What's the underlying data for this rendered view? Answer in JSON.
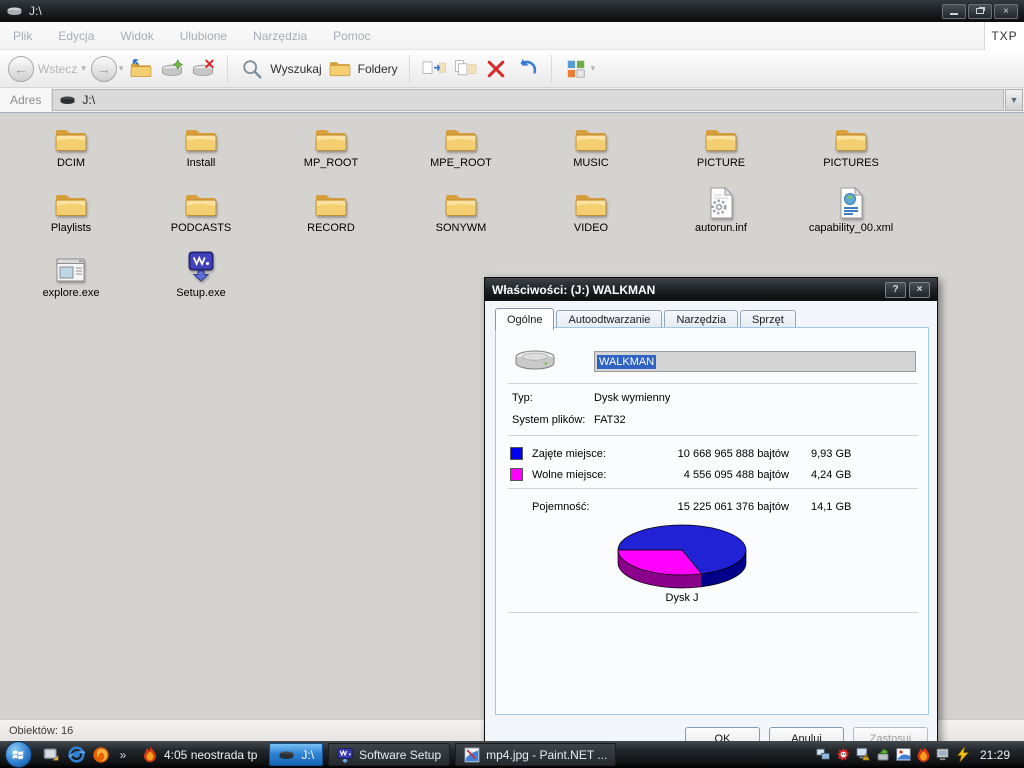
{
  "window": {
    "title": "J:\\",
    "controls": [
      "minimize",
      "restore",
      "close"
    ]
  },
  "menu_bar": {
    "items": [
      "Plik",
      "Edycja",
      "Widok",
      "Ulubione",
      "Narzędzia",
      "Pomoc"
    ],
    "right_label": "TXP"
  },
  "toolbar": {
    "back_label": "Wstecz",
    "search_label": "Wyszukaj",
    "folders_label": "Foldery",
    "caret": "▾"
  },
  "address_bar": {
    "label": "Adres",
    "value": "J:\\"
  },
  "files": [
    {
      "name": "DCIM",
      "icon": "folder"
    },
    {
      "name": "Install",
      "icon": "folder"
    },
    {
      "name": "MP_ROOT",
      "icon": "folder"
    },
    {
      "name": "MPE_ROOT",
      "icon": "folder"
    },
    {
      "name": "MUSIC",
      "icon": "folder"
    },
    {
      "name": "PICTURE",
      "icon": "folder"
    },
    {
      "name": "PICTURES",
      "icon": "folder"
    },
    {
      "name": "Playlists",
      "icon": "folder"
    },
    {
      "name": "PODCASTS",
      "icon": "folder"
    },
    {
      "name": "RECORD",
      "icon": "folder"
    },
    {
      "name": "SONYWM",
      "icon": "folder"
    },
    {
      "name": "VIDEO",
      "icon": "folder"
    },
    {
      "name": "autorun.inf",
      "icon": "inf-file"
    },
    {
      "name": "capability_00.xml",
      "icon": "xml-file"
    },
    {
      "name": "explore.exe",
      "icon": "app-window"
    },
    {
      "name": "Setup.exe",
      "icon": "walkman-setup"
    }
  ],
  "status_bar": {
    "text": "Obiektów: 16"
  },
  "dialog": {
    "title": "Właściwości: (J:) WALKMAN",
    "title_buttons": [
      "?",
      "×"
    ],
    "tabs": [
      {
        "label": "Ogólne",
        "active": true
      },
      {
        "label": "Autoodtwarzanie"
      },
      {
        "label": "Narzędzia"
      },
      {
        "label": "Sprzęt"
      }
    ],
    "volume_label": "WALKMAN",
    "info_rows": [
      {
        "label": "Typ:",
        "value": "Dysk wymienny"
      },
      {
        "label": "System plików:",
        "value": "FAT32"
      }
    ],
    "usage": [
      {
        "label": "Zajęte miejsce:",
        "bytes": "10 668 965 888 bajtów",
        "size": "9,93 GB",
        "color": "#0000ee"
      },
      {
        "label": "Wolne miejsce:",
        "bytes": "4 556 095 488 bajtów",
        "size": "4,24 GB",
        "color": "#ff00ff"
      }
    ],
    "capacity": {
      "label": "Pojemność:",
      "bytes": "15 225 061 376 bajtów",
      "size": "14,1 GB"
    },
    "buttons": [
      {
        "label": "OK"
      },
      {
        "label": "Anuluj"
      },
      {
        "label": "Zastosuj",
        "disabled": true
      }
    ]
  },
  "chart_data": {
    "type": "pie",
    "title": "Dysk J",
    "labels": [
      "Zajęte miejsce",
      "Wolne miejsce"
    ],
    "values_bytes": [
      10668965888,
      4556095488
    ],
    "values_gb": [
      9.93,
      4.24
    ],
    "total_bytes": 15225061376,
    "total_gb": 14.1,
    "colors": [
      "#2121d6",
      "#ff00ff"
    ],
    "side_colors": [
      "#00008b",
      "#8b008b"
    ],
    "legend_position": "in-dialog-above",
    "style": "3d-pie"
  },
  "taskbar": {
    "quick_launch": [
      "show-desktop",
      "internet-explorer",
      "firefox"
    ],
    "overflow_chevron": "»",
    "connection": {
      "label": "4:05 neostrada tp",
      "icon": "flame"
    },
    "tasks": [
      {
        "label": "J:\\",
        "icon": "drive-dark",
        "active": true
      },
      {
        "label": "Software Setup",
        "icon": "walkman-small"
      },
      {
        "label": "mp4.jpg - Paint.NET ...",
        "icon": "paintnet"
      }
    ],
    "tray": [
      "network-monitors",
      "virus-ball",
      "monitor-warning",
      "usb-device",
      "photo-viewer",
      "flame",
      "monitor-gray",
      "lightning"
    ],
    "clock": "21:29"
  }
}
